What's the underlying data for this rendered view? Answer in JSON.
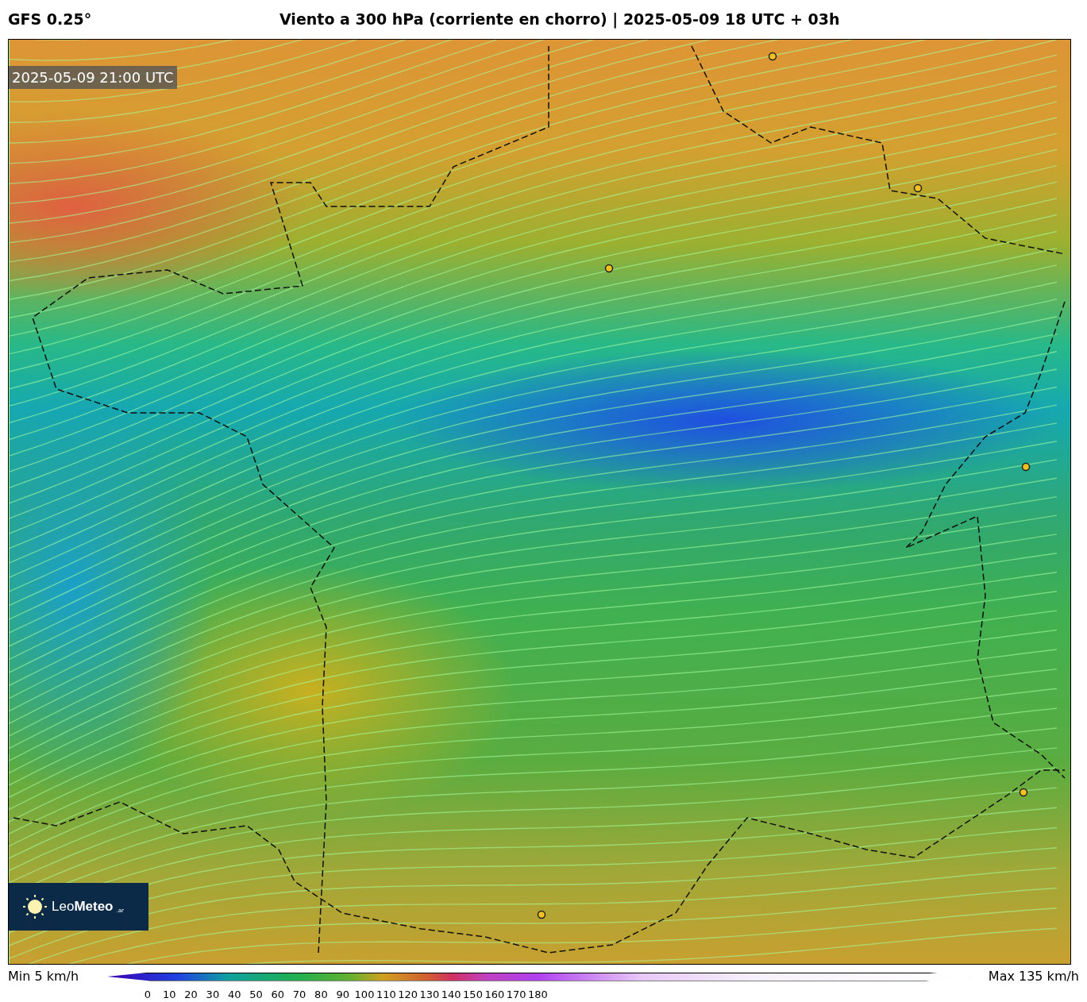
{
  "header": {
    "model": "GFS 0.25°",
    "title": "Viento a 300 hPa (corriente en chorro) | 2025-05-09 18 UTC + 03h"
  },
  "map": {
    "timestamp": "2025-05-09 21:00 UTC"
  },
  "logo": {
    "name": "Leo**Meteo**",
    "suffix": ".ar"
  },
  "colorbar": {
    "min_label": "Min 5 km/h",
    "max_label": "Max 135 km/h",
    "ticks": [
      "0",
      "10",
      "20",
      "30",
      "40",
      "50",
      "60",
      "70",
      "80",
      "90",
      "100",
      "110",
      "120",
      "130",
      "140",
      "150",
      "160",
      "170",
      "180"
    ]
  }
}
